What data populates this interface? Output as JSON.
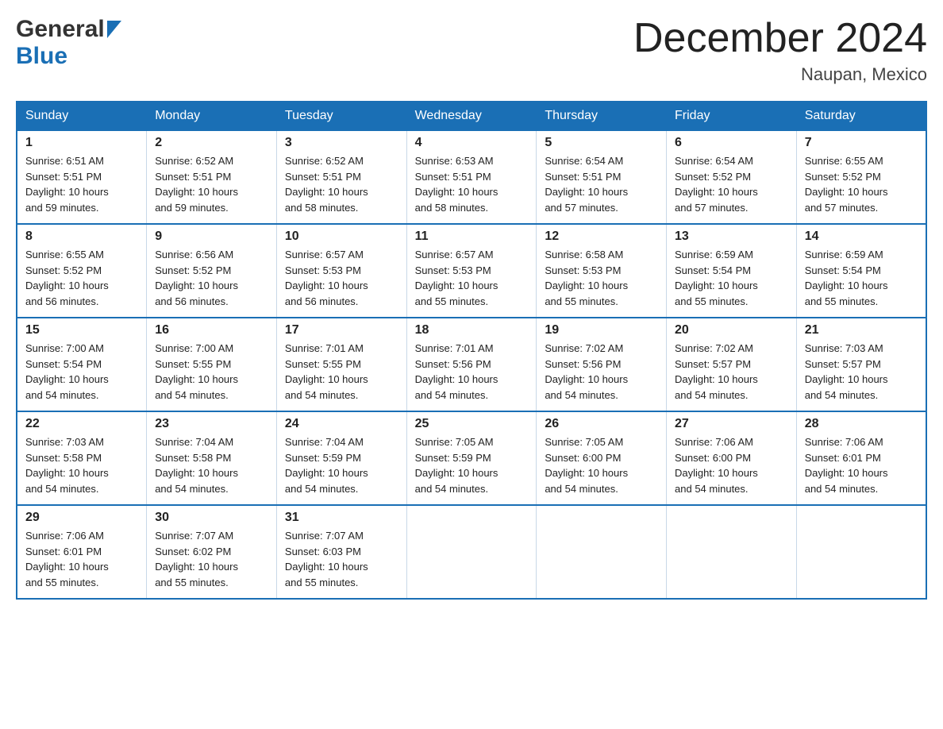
{
  "header": {
    "logo_general": "General",
    "logo_blue": "Blue",
    "month_title": "December 2024",
    "location": "Naupan, Mexico"
  },
  "weekdays": [
    "Sunday",
    "Monday",
    "Tuesday",
    "Wednesday",
    "Thursday",
    "Friday",
    "Saturday"
  ],
  "weeks": [
    [
      {
        "day": "1",
        "sunrise": "6:51 AM",
        "sunset": "5:51 PM",
        "daylight": "10 hours and 59 minutes."
      },
      {
        "day": "2",
        "sunrise": "6:52 AM",
        "sunset": "5:51 PM",
        "daylight": "10 hours and 59 minutes."
      },
      {
        "day": "3",
        "sunrise": "6:52 AM",
        "sunset": "5:51 PM",
        "daylight": "10 hours and 58 minutes."
      },
      {
        "day": "4",
        "sunrise": "6:53 AM",
        "sunset": "5:51 PM",
        "daylight": "10 hours and 58 minutes."
      },
      {
        "day": "5",
        "sunrise": "6:54 AM",
        "sunset": "5:51 PM",
        "daylight": "10 hours and 57 minutes."
      },
      {
        "day": "6",
        "sunrise": "6:54 AM",
        "sunset": "5:52 PM",
        "daylight": "10 hours and 57 minutes."
      },
      {
        "day": "7",
        "sunrise": "6:55 AM",
        "sunset": "5:52 PM",
        "daylight": "10 hours and 57 minutes."
      }
    ],
    [
      {
        "day": "8",
        "sunrise": "6:55 AM",
        "sunset": "5:52 PM",
        "daylight": "10 hours and 56 minutes."
      },
      {
        "day": "9",
        "sunrise": "6:56 AM",
        "sunset": "5:52 PM",
        "daylight": "10 hours and 56 minutes."
      },
      {
        "day": "10",
        "sunrise": "6:57 AM",
        "sunset": "5:53 PM",
        "daylight": "10 hours and 56 minutes."
      },
      {
        "day": "11",
        "sunrise": "6:57 AM",
        "sunset": "5:53 PM",
        "daylight": "10 hours and 55 minutes."
      },
      {
        "day": "12",
        "sunrise": "6:58 AM",
        "sunset": "5:53 PM",
        "daylight": "10 hours and 55 minutes."
      },
      {
        "day": "13",
        "sunrise": "6:59 AM",
        "sunset": "5:54 PM",
        "daylight": "10 hours and 55 minutes."
      },
      {
        "day": "14",
        "sunrise": "6:59 AM",
        "sunset": "5:54 PM",
        "daylight": "10 hours and 55 minutes."
      }
    ],
    [
      {
        "day": "15",
        "sunrise": "7:00 AM",
        "sunset": "5:54 PM",
        "daylight": "10 hours and 54 minutes."
      },
      {
        "day": "16",
        "sunrise": "7:00 AM",
        "sunset": "5:55 PM",
        "daylight": "10 hours and 54 minutes."
      },
      {
        "day": "17",
        "sunrise": "7:01 AM",
        "sunset": "5:55 PM",
        "daylight": "10 hours and 54 minutes."
      },
      {
        "day": "18",
        "sunrise": "7:01 AM",
        "sunset": "5:56 PM",
        "daylight": "10 hours and 54 minutes."
      },
      {
        "day": "19",
        "sunrise": "7:02 AM",
        "sunset": "5:56 PM",
        "daylight": "10 hours and 54 minutes."
      },
      {
        "day": "20",
        "sunrise": "7:02 AM",
        "sunset": "5:57 PM",
        "daylight": "10 hours and 54 minutes."
      },
      {
        "day": "21",
        "sunrise": "7:03 AM",
        "sunset": "5:57 PM",
        "daylight": "10 hours and 54 minutes."
      }
    ],
    [
      {
        "day": "22",
        "sunrise": "7:03 AM",
        "sunset": "5:58 PM",
        "daylight": "10 hours and 54 minutes."
      },
      {
        "day": "23",
        "sunrise": "7:04 AM",
        "sunset": "5:58 PM",
        "daylight": "10 hours and 54 minutes."
      },
      {
        "day": "24",
        "sunrise": "7:04 AM",
        "sunset": "5:59 PM",
        "daylight": "10 hours and 54 minutes."
      },
      {
        "day": "25",
        "sunrise": "7:05 AM",
        "sunset": "5:59 PM",
        "daylight": "10 hours and 54 minutes."
      },
      {
        "day": "26",
        "sunrise": "7:05 AM",
        "sunset": "6:00 PM",
        "daylight": "10 hours and 54 minutes."
      },
      {
        "day": "27",
        "sunrise": "7:06 AM",
        "sunset": "6:00 PM",
        "daylight": "10 hours and 54 minutes."
      },
      {
        "day": "28",
        "sunrise": "7:06 AM",
        "sunset": "6:01 PM",
        "daylight": "10 hours and 54 minutes."
      }
    ],
    [
      {
        "day": "29",
        "sunrise": "7:06 AM",
        "sunset": "6:01 PM",
        "daylight": "10 hours and 55 minutes."
      },
      {
        "day": "30",
        "sunrise": "7:07 AM",
        "sunset": "6:02 PM",
        "daylight": "10 hours and 55 minutes."
      },
      {
        "day": "31",
        "sunrise": "7:07 AM",
        "sunset": "6:03 PM",
        "daylight": "10 hours and 55 minutes."
      },
      null,
      null,
      null,
      null
    ]
  ],
  "sunrise_label": "Sunrise: ",
  "sunset_label": "Sunset: ",
  "daylight_label": "Daylight: "
}
